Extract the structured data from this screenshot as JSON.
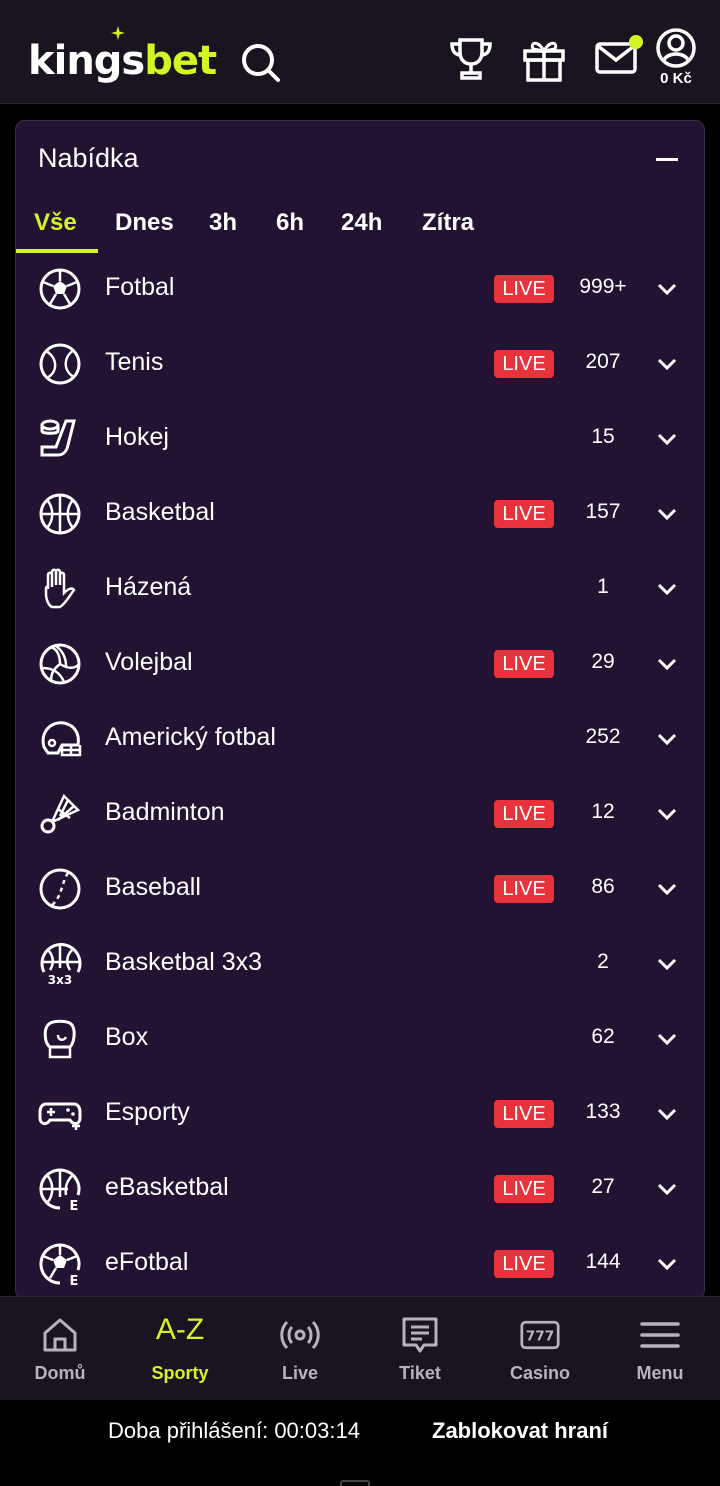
{
  "header": {
    "logo_king": "king",
    "logo_s": "s",
    "logo_bet": "bet",
    "balance": "0 Kč"
  },
  "panel": {
    "title": "Nabídka",
    "tabs": [
      "Vše",
      "Dnes",
      "3h",
      "6h",
      "24h",
      "Zítra"
    ],
    "active_tab": "Vše"
  },
  "sports": [
    {
      "name": "Fotbal",
      "live": "LIVE",
      "count": "999+",
      "icon": "soccer-ball-icon"
    },
    {
      "name": "Tenis",
      "live": "LIVE",
      "count": "207",
      "icon": "tennis-ball-icon"
    },
    {
      "name": "Hokej",
      "live": "",
      "count": "15",
      "icon": "hockey-stick-icon"
    },
    {
      "name": "Basketbal",
      "live": "LIVE",
      "count": "157",
      "icon": "basketball-icon"
    },
    {
      "name": "Házená",
      "live": "",
      "count": "1",
      "icon": "handball-hand-icon"
    },
    {
      "name": "Volejbal",
      "live": "LIVE",
      "count": "29",
      "icon": "volleyball-icon"
    },
    {
      "name": "Americký fotbal",
      "live": "",
      "count": "252",
      "icon": "football-helmet-icon"
    },
    {
      "name": "Badminton",
      "live": "LIVE",
      "count": "12",
      "icon": "shuttlecock-icon"
    },
    {
      "name": "Baseball",
      "live": "LIVE",
      "count": "86",
      "icon": "baseball-icon"
    },
    {
      "name": "Basketbal 3x3",
      "live": "",
      "count": "2",
      "icon": "basketball-3x3-icon"
    },
    {
      "name": "Box",
      "live": "",
      "count": "62",
      "icon": "boxing-glove-icon"
    },
    {
      "name": "Esporty",
      "live": "LIVE",
      "count": "133",
      "icon": "gamepad-icon"
    },
    {
      "name": "eBasketbal",
      "live": "LIVE",
      "count": "27",
      "icon": "ebasketball-icon"
    },
    {
      "name": "eFotbal",
      "live": "LIVE",
      "count": "144",
      "icon": "esoccer-icon"
    }
  ],
  "icon_badges": {
    "three_x_three": "3x3",
    "e": "E"
  },
  "bottom_nav": [
    {
      "label": "Domů",
      "icon": "home-icon"
    },
    {
      "label": "Sporty",
      "icon": "az-icon",
      "glyph": "A-Z",
      "active": true
    },
    {
      "label": "Live",
      "icon": "live-broadcast-icon"
    },
    {
      "label": "Tiket",
      "icon": "ticket-icon"
    },
    {
      "label": "Casino",
      "icon": "slot-777-icon",
      "glyph": "777"
    },
    {
      "label": "Menu",
      "icon": "hamburger-menu-icon"
    }
  ],
  "footer": {
    "session": "Doba přihlášení: 00:03:14",
    "block_button": "Zablokovat hraní"
  },
  "colors": {
    "accent": "#d4f524",
    "live": "#e8323c",
    "panel_bg": "#211331",
    "header_bg": "#1a1420"
  }
}
